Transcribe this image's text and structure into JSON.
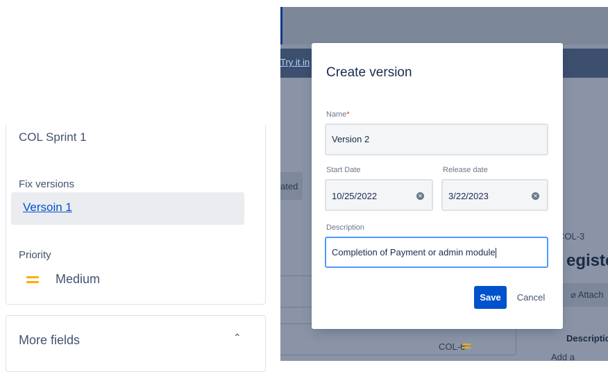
{
  "left_panel": {
    "sprint_value": "COL Sprint 1",
    "fix_versions_label": "Fix versions",
    "fix_versions_value": "Versoin 1",
    "priority_label": "Priority",
    "priority_value": "Medium",
    "priority_icon": "medium-priority-icon",
    "more_fields_label": "More fields",
    "more_fields_icon": "chevron-up-icon",
    "more_fields_chevron": "⌃"
  },
  "background": {
    "try_it_link": "Try it in",
    "ated_text": "ated",
    "issue_key": "COL-3",
    "title_fragment": "egister",
    "attach_label": "Attach",
    "attach_icon": "paperclip-icon",
    "row_issue_key": "COL-6",
    "description_heading": "Description",
    "add_description": "Add a descripti"
  },
  "modal": {
    "title": "Create version",
    "name_label": "Name",
    "required_mark": "*",
    "name_value": "Version 2",
    "start_date_label": "Start Date",
    "start_date_value": "10/25/2022",
    "release_date_label": "Release date",
    "release_date_value": "3/22/2023",
    "clear_icon": "clear-icon",
    "clear_glyph": "✕",
    "description_label": "Description",
    "description_value": "Completion of Payment or admin module",
    "save_label": "Save",
    "cancel_label": "Cancel"
  },
  "colors": {
    "primary": "#0052cc",
    "priority_medium": "#ffab00",
    "focus_border": "#4c9aff",
    "required": "#de350b",
    "overlay": "#8590a3"
  }
}
